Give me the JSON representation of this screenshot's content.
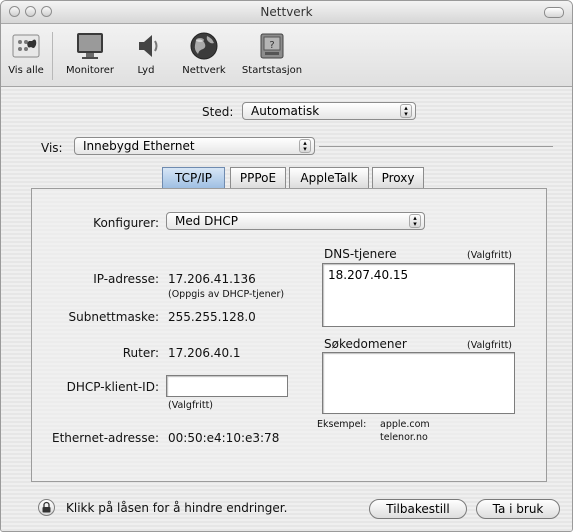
{
  "window": {
    "title": "Nettverk"
  },
  "toolbar": {
    "items": [
      {
        "label": "Vis alle",
        "icon": "apple-grid-icon"
      },
      {
        "label": "Monitorer",
        "icon": "monitor-icon"
      },
      {
        "label": "Lyd",
        "icon": "speaker-icon"
      },
      {
        "label": "Nettverk",
        "icon": "globe-icon"
      },
      {
        "label": "Startstasjon",
        "icon": "disk-icon"
      }
    ]
  },
  "location": {
    "label": "Sted:",
    "value": "Automatisk"
  },
  "show": {
    "label": "Vis:",
    "value": "Innebygd Ethernet"
  },
  "tabs": [
    {
      "label": "TCP/IP",
      "active": true
    },
    {
      "label": "PPPoE",
      "active": false
    },
    {
      "label": "AppleTalk",
      "active": false
    },
    {
      "label": "Proxy",
      "active": false
    }
  ],
  "tcpip": {
    "configure": {
      "label": "Konfigurer:",
      "value": "Med DHCP"
    },
    "ip": {
      "label": "IP-adresse:",
      "value": "17.206.41.136",
      "note": "(Oppgis av DHCP-tjener)"
    },
    "subnet": {
      "label": "Subnettmaske:",
      "value": "255.255.128.0"
    },
    "router": {
      "label": "Ruter:",
      "value": "17.206.40.1"
    },
    "dhcp_client": {
      "label": "DHCP-klient-ID:",
      "value": "",
      "note": "(Valgfritt)"
    },
    "ethernet": {
      "label": "Ethernet-adresse:",
      "value": "00:50:e4:10:e3:78"
    },
    "dns": {
      "label": "DNS-tjenere",
      "optional": "(Valgfritt)",
      "value": "18.207.40.15"
    },
    "search": {
      "label": "Søkedomener",
      "optional": "(Valgfritt)",
      "value": ""
    },
    "example": {
      "label": "Eksempel:",
      "line1": "apple.com",
      "line2": "telenor.no"
    }
  },
  "footer": {
    "lock_text": "Klikk på låsen for å hindre endringer.",
    "revert_label": "Tilbakestill",
    "apply_label": "Ta i bruk"
  }
}
